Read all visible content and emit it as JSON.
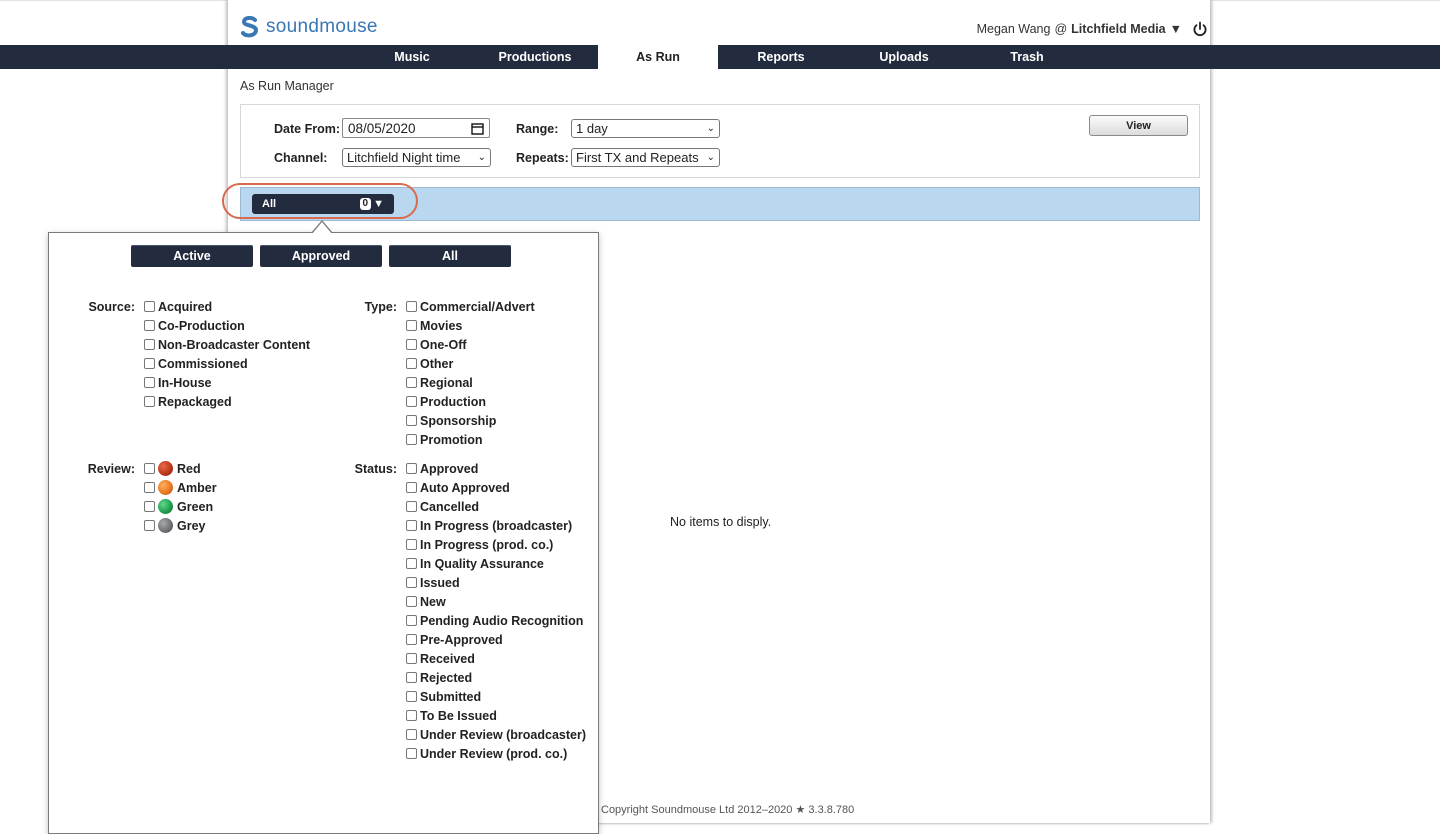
{
  "app": {
    "logo_text": "soundmouse",
    "user_name": "Megan Wang",
    "at": "@",
    "org": "Litchfield Media",
    "org_caret": "▼"
  },
  "nav": {
    "tabs": [
      {
        "label": "Music"
      },
      {
        "label": "Productions"
      },
      {
        "label": "As Run",
        "active": true
      },
      {
        "label": "Reports"
      },
      {
        "label": "Uploads"
      },
      {
        "label": "Trash"
      }
    ]
  },
  "breadcrumb": "As Run Manager",
  "filters": {
    "date_from_label": "Date From:",
    "date_from_value": "08/05/2020",
    "range_label": "Range:",
    "range_value": "1 day",
    "channel_label": "Channel:",
    "channel_value": "Litchfield Night time",
    "repeats_label": "Repeats:",
    "repeats_value": "First TX and Repeats",
    "view_label": "View"
  },
  "status_dropdown": {
    "label": "All",
    "count": "0",
    "caret": "▼"
  },
  "popover": {
    "buttons": [
      "Active",
      "Approved",
      "All"
    ],
    "source": {
      "label": "Source:",
      "options": [
        "Acquired",
        "Co-Production",
        "Non-Broadcaster Content",
        "Commissioned",
        "In-House",
        "Repackaged"
      ]
    },
    "type": {
      "label": "Type:",
      "options": [
        "Commercial/Advert",
        "Movies",
        "One-Off",
        "Other",
        "Regional",
        "Production",
        "Sponsorship",
        "Promotion"
      ]
    },
    "review": {
      "label": "Review:",
      "options": [
        {
          "label": "Red",
          "color": "#b8341a"
        },
        {
          "label": "Amber",
          "color": "#e8741c"
        },
        {
          "label": "Green",
          "color": "#1f9a4c"
        },
        {
          "label": "Grey",
          "color": "#6d6e72"
        }
      ]
    },
    "status": {
      "label": "Status:",
      "options": [
        "Approved",
        "Auto Approved",
        "Cancelled",
        "In Progress (broadcaster)",
        "In Progress (prod. co.)",
        "In Quality Assurance",
        "Issued",
        "New",
        "Pending Audio Recognition",
        "Pre-Approved",
        "Received",
        "Rejected",
        "Submitted",
        "To Be Issued",
        "Under Review (broadcaster)",
        "Under Review (prod. co.)"
      ]
    }
  },
  "empty_message": "No items to disply.",
  "copyright": "Copyright Soundmouse Ltd 2012–2020 ★ 3.3.8.780",
  "colors": {
    "navbar": "#232c3f",
    "accent_blue": "#b9d8ef",
    "brand": "#3a77b5",
    "highlight": "#d86a4e"
  }
}
